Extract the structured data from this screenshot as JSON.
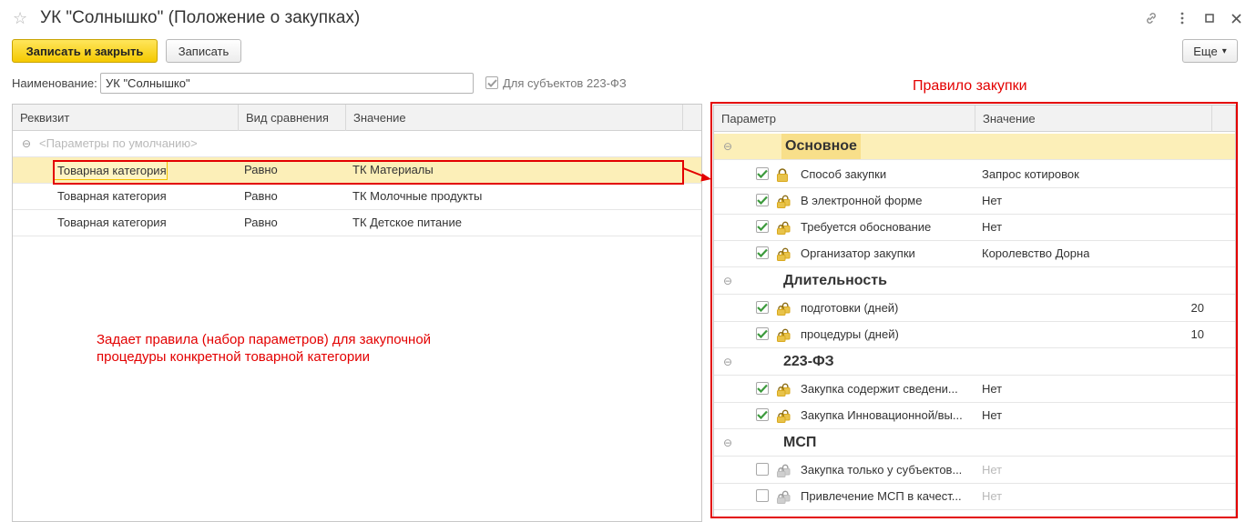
{
  "window": {
    "title": "УК \"Солнышко\" (Положение о закупках)"
  },
  "toolbar": {
    "save_close_label": "Записать и закрыть",
    "save_label": "Записать",
    "more_label": "Еще",
    "more_arrow": "▾"
  },
  "form": {
    "name_label": "Наименование:",
    "name_value": "УК \"Солнышко\"",
    "flag_label": "Для субъектов 223-ФЗ",
    "flag_checked": true
  },
  "left_grid": {
    "columns": [
      "Реквизит",
      "Вид сравнения",
      "Значение"
    ],
    "group_label": "<Параметры по умолчанию>",
    "rows": [
      {
        "attribute": "Товарная категория",
        "comparison": "Равно",
        "value": "ТК Материалы",
        "selected": true
      },
      {
        "attribute": "Товарная категория",
        "comparison": "Равно",
        "value": "ТК Молочные продукты",
        "selected": false
      },
      {
        "attribute": "Товарная категория",
        "comparison": "Равно",
        "value": "ТК Детское питание",
        "selected": false
      }
    ]
  },
  "annotations": {
    "left_note_line1": "Задает правила (набор параметров) для закупочной",
    "left_note_line2": "процедуры  конкретной товарной категории",
    "right_title": "Правило закупки",
    "accent_color": "#e30000"
  },
  "right_grid": {
    "columns": [
      "Параметр",
      "Значение"
    ],
    "groups": [
      {
        "title": "Основное",
        "items": [
          {
            "checked": true,
            "name": "Способ закупки",
            "value": "Запрос котировок",
            "lock": "single"
          },
          {
            "checked": true,
            "name": "В электронной форме",
            "value": "Нет",
            "lock": "double"
          },
          {
            "checked": true,
            "name": "Требуется обоснование",
            "value": "Нет",
            "lock": "double"
          },
          {
            "checked": true,
            "name": "Организатор закупки",
            "value": "Королевство Дорна",
            "lock": "double"
          }
        ]
      },
      {
        "title": "Длительность",
        "items": [
          {
            "checked": true,
            "name": "подготовки (дней)",
            "value": "20",
            "lock": "double",
            "numeric": true
          },
          {
            "checked": true,
            "name": "процедуры (дней)",
            "value": "10",
            "lock": "double",
            "numeric": true
          }
        ]
      },
      {
        "title": "223-ФЗ",
        "items": [
          {
            "checked": true,
            "name": "Закупка содержит сведени...",
            "value": "Нет",
            "lock": "double"
          },
          {
            "checked": true,
            "name": "Закупка Инновационной/вы...",
            "value": "Нет",
            "lock": "double"
          }
        ]
      },
      {
        "title": "МСП",
        "items": [
          {
            "checked": false,
            "name": "Закупка только у субъектов...",
            "value": "Нет",
            "lock": "double-grey"
          },
          {
            "checked": false,
            "name": "Привлечение МСП в качест...",
            "value": "Нет",
            "lock": "double-grey"
          }
        ]
      }
    ]
  },
  "colors": {
    "primary_button": "#f5c900",
    "selection": "#fcefb8",
    "check": "#3c9a3c"
  }
}
